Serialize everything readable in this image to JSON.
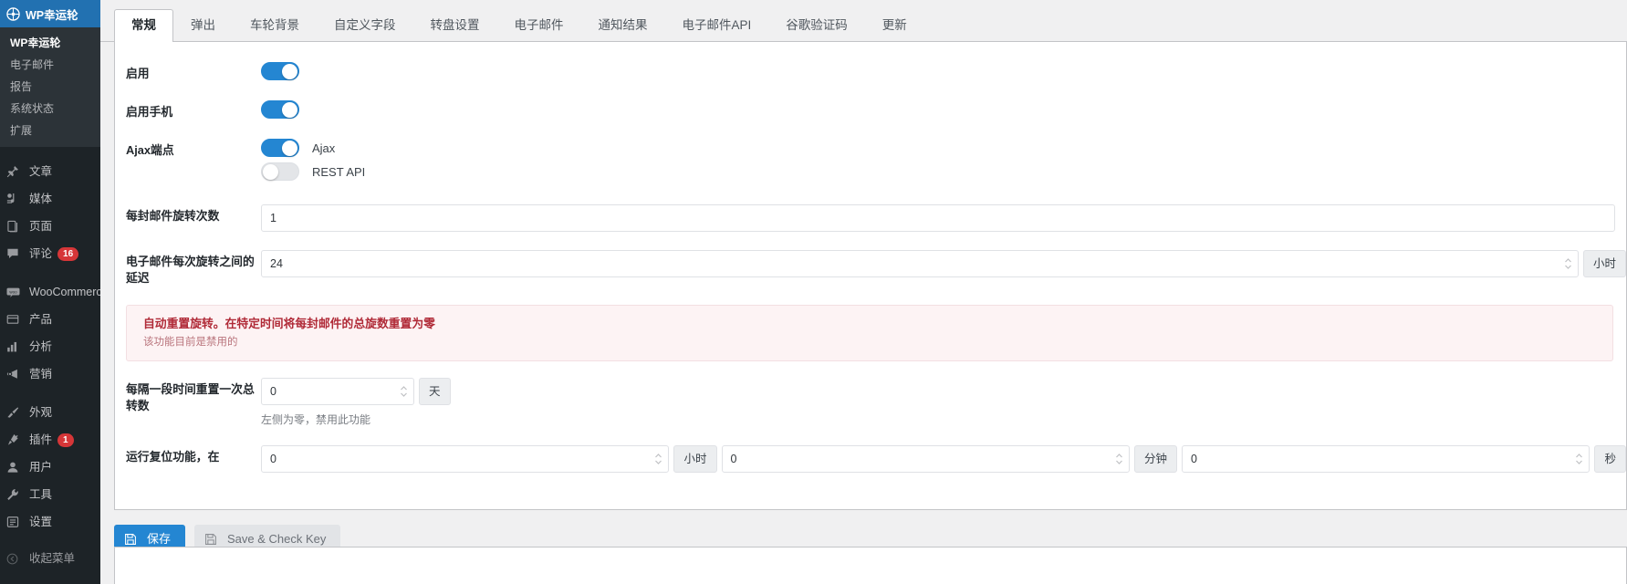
{
  "sidebar": {
    "current_menu": {
      "label": "WP幸运轮",
      "icon": "wheel-icon"
    },
    "submenu": [
      {
        "label": "WP幸运轮",
        "current": true
      },
      {
        "label": "电子邮件",
        "current": false
      },
      {
        "label": "报告",
        "current": false
      },
      {
        "label": "系统状态",
        "current": false
      },
      {
        "label": "扩展",
        "current": false
      }
    ],
    "groups": [
      [
        {
          "label": "文章",
          "icon": "pin-icon",
          "badge": null
        },
        {
          "label": "媒体",
          "icon": "media-icon",
          "badge": null
        },
        {
          "label": "页面",
          "icon": "page-icon",
          "badge": null
        },
        {
          "label": "评论",
          "icon": "comment-icon",
          "badge": "16"
        }
      ],
      [
        {
          "label": "WooCommerce",
          "icon": "woocommerce-icon",
          "badge": null
        },
        {
          "label": "产品",
          "icon": "product-icon",
          "badge": null
        },
        {
          "label": "分析",
          "icon": "chart-icon",
          "badge": null
        },
        {
          "label": "营销",
          "icon": "megaphone-icon",
          "badge": null
        }
      ],
      [
        {
          "label": "外观",
          "icon": "brush-icon",
          "badge": null
        },
        {
          "label": "插件",
          "icon": "plugin-icon",
          "badge": "1"
        },
        {
          "label": "用户",
          "icon": "user-icon",
          "badge": null
        },
        {
          "label": "工具",
          "icon": "wrench-icon",
          "badge": null
        },
        {
          "label": "设置",
          "icon": "settings-icon",
          "badge": null
        }
      ]
    ],
    "collapse": {
      "label": "收起菜单",
      "icon": "collapse-icon"
    }
  },
  "tabs": [
    {
      "label": "常规",
      "active": true
    },
    {
      "label": "弹出",
      "active": false
    },
    {
      "label": "车轮背景",
      "active": false
    },
    {
      "label": "自定义字段",
      "active": false
    },
    {
      "label": "转盘设置",
      "active": false
    },
    {
      "label": "电子邮件",
      "active": false
    },
    {
      "label": "通知结果",
      "active": false
    },
    {
      "label": "电子邮件API",
      "active": false
    },
    {
      "label": "谷歌验证码",
      "active": false
    },
    {
      "label": "更新",
      "active": false
    }
  ],
  "form": {
    "enable": {
      "label": "启用",
      "state": "on"
    },
    "enable_mobile": {
      "label": "启用手机",
      "state": "on"
    },
    "ajax_endpoint": {
      "label": "Ajax端点",
      "options": [
        {
          "label": "Ajax",
          "state": "on"
        },
        {
          "label": "REST API",
          "state": "off"
        }
      ]
    },
    "spins_per_email": {
      "label": "每封邮件旋转次数",
      "value": "1"
    },
    "delay_between_spins": {
      "label": "电子邮件每次旋转之间的延迟",
      "value": "24",
      "unit": "小时"
    },
    "notice": {
      "title": "自动重置旋转。在特定时间将每封邮件的总旋数重置为零",
      "subtitle": "该功能目前是禁用的"
    },
    "reset_interval": {
      "label": "每隔一段时间重置一次总转数",
      "value": "0",
      "unit": "天",
      "help": "左侧为零，禁用此功能"
    },
    "run_reset_at": {
      "label": "运行复位功能，在",
      "hours": {
        "value": "0",
        "unit": "小时"
      },
      "minutes": {
        "value": "0",
        "unit": "分钟"
      },
      "seconds": {
        "value": "0",
        "unit": "秒"
      }
    }
  },
  "actions": {
    "save": {
      "label": "保存",
      "icon": "floppy-icon"
    },
    "save_check_key": {
      "label": "Save & Check Key",
      "icon": "floppy-icon"
    }
  },
  "colors": {
    "accent": "#2486d2",
    "sidebar_bg": "#1d2327",
    "badge": "#d63638",
    "notice_text": "#b02a37"
  }
}
